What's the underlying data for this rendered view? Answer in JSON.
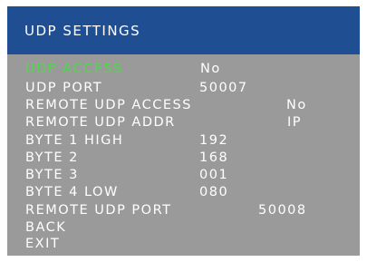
{
  "colors": {
    "title_bar": "#1f4e93",
    "panel": "#9a9a9a",
    "text": "#ffffff",
    "selected": "#52d64c"
  },
  "title": "UDP SETTINGS",
  "items": [
    {
      "label": "UDP ACCESS",
      "value": "No"
    },
    {
      "label": "UDP PORT",
      "value": "50007"
    },
    {
      "label": "REMOTE UDP ACCESS",
      "value": "No"
    },
    {
      "label": "REMOTE UDP ADDR",
      "value": "IP"
    },
    {
      "label": "BYTE 1 HIGH",
      "value": "192"
    },
    {
      "label": "BYTE 2",
      "value": "168"
    },
    {
      "label": "BYTE 3",
      "value": "001"
    },
    {
      "label": "BYTE 4 LOW",
      "value": "080"
    },
    {
      "label": "REMOTE UDP PORT",
      "value": "50008"
    },
    {
      "label": "BACK",
      "value": ""
    },
    {
      "label": "EXIT",
      "value": ""
    }
  ],
  "selected_item": "UDP ACCESS"
}
